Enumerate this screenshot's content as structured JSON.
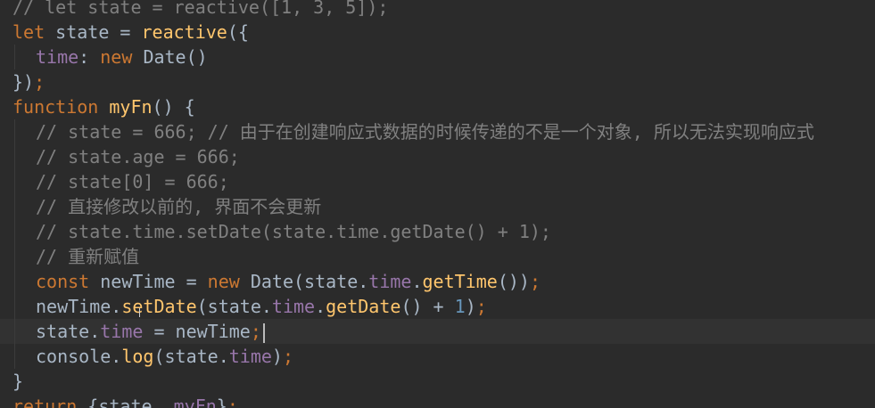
{
  "editor": {
    "colors": {
      "background": "#2b2b2b",
      "current_line": "#323232",
      "keyword": "#cc7832",
      "function": "#ffc66d",
      "property": "#9876aa",
      "number": "#6897bb",
      "comment": "#808080",
      "plain": "#a9b7c6"
    },
    "lines": [
      {
        "indent": 0,
        "tokens": [
          {
            "t": "// let state = reactive([1, 3, 5]);",
            "c": "comment"
          }
        ]
      },
      {
        "indent": 0,
        "tokens": [
          {
            "t": "let ",
            "c": "keyword"
          },
          {
            "t": "state = ",
            "c": "plain"
          },
          {
            "t": "reactive",
            "c": "function"
          },
          {
            "t": "({",
            "c": "plain"
          }
        ]
      },
      {
        "indent": 1,
        "tokens": [
          {
            "t": "time",
            "c": "property"
          },
          {
            "t": ": ",
            "c": "plain"
          },
          {
            "t": "new ",
            "c": "keyword"
          },
          {
            "t": "Date()",
            "c": "plain"
          }
        ]
      },
      {
        "indent": 0,
        "tokens": [
          {
            "t": "})",
            "c": "plain"
          },
          {
            "t": ";",
            "c": "keyword"
          }
        ]
      },
      {
        "indent": 0,
        "tokens": [
          {
            "t": "function ",
            "c": "keyword"
          },
          {
            "t": "myFn",
            "c": "function"
          },
          {
            "t": "() {",
            "c": "plain"
          }
        ]
      },
      {
        "indent": 1,
        "tokens": [
          {
            "t": "// state = 666; // 由于在创建响应式数据的时候传递的不是一个对象, 所以无法实现响应式",
            "c": "comment"
          }
        ]
      },
      {
        "indent": 1,
        "tokens": [
          {
            "t": "// state.age = 666;",
            "c": "comment"
          }
        ]
      },
      {
        "indent": 1,
        "tokens": [
          {
            "t": "// state[0] = 666;",
            "c": "comment"
          }
        ]
      },
      {
        "indent": 1,
        "tokens": [
          {
            "t": "// 直接修改以前的, 界面不会更新",
            "c": "comment"
          }
        ]
      },
      {
        "indent": 1,
        "tokens": [
          {
            "t": "// state.time.setDate(state.time.getDate() + 1);",
            "c": "comment"
          }
        ]
      },
      {
        "indent": 1,
        "tokens": [
          {
            "t": "// 重新赋值",
            "c": "comment"
          }
        ]
      },
      {
        "indent": 1,
        "tokens": [
          {
            "t": "const ",
            "c": "keyword"
          },
          {
            "t": "newTime = ",
            "c": "plain"
          },
          {
            "t": "new ",
            "c": "keyword"
          },
          {
            "t": "Date(state.",
            "c": "plain"
          },
          {
            "t": "time",
            "c": "property"
          },
          {
            "t": ".",
            "c": "plain"
          },
          {
            "t": "getTime",
            "c": "function"
          },
          {
            "t": "())",
            "c": "plain"
          },
          {
            "t": ";",
            "c": "keyword"
          }
        ]
      },
      {
        "indent": 1,
        "tokens": [
          {
            "t": "newTime.",
            "c": "plain"
          },
          {
            "t": "setDate",
            "c": "function"
          },
          {
            "t": "(state.",
            "c": "plain"
          },
          {
            "t": "time",
            "c": "property"
          },
          {
            "t": ".",
            "c": "plain"
          },
          {
            "t": "getDate",
            "c": "function"
          },
          {
            "t": "() + ",
            "c": "plain"
          },
          {
            "t": "1",
            "c": "number"
          },
          {
            "t": ")",
            "c": "plain"
          },
          {
            "t": ";",
            "c": "keyword"
          }
        ]
      },
      {
        "indent": 1,
        "current": true,
        "caret": true,
        "tokens": [
          {
            "t": "state.",
            "c": "plain"
          },
          {
            "t": "time",
            "c": "property"
          },
          {
            "t": " = newTime",
            "c": "plain"
          },
          {
            "t": ";",
            "c": "keyword"
          }
        ]
      },
      {
        "indent": 1,
        "tokens": [
          {
            "t": "console.",
            "c": "plain"
          },
          {
            "t": "log",
            "c": "function"
          },
          {
            "t": "(state.",
            "c": "plain"
          },
          {
            "t": "time",
            "c": "property"
          },
          {
            "t": ")",
            "c": "plain"
          },
          {
            "t": ";",
            "c": "keyword"
          }
        ]
      },
      {
        "indent": 0,
        "tokens": [
          {
            "t": "}",
            "c": "plain"
          }
        ]
      },
      {
        "indent": 0,
        "tokens": [
          {
            "t": "return ",
            "c": "keyword"
          },
          {
            "t": "{state, ",
            "c": "plain"
          },
          {
            "t": "myFn",
            "c": "property"
          },
          {
            "t": "}",
            "c": "plain"
          },
          {
            "t": ";",
            "c": "keyword"
          }
        ]
      }
    ]
  }
}
